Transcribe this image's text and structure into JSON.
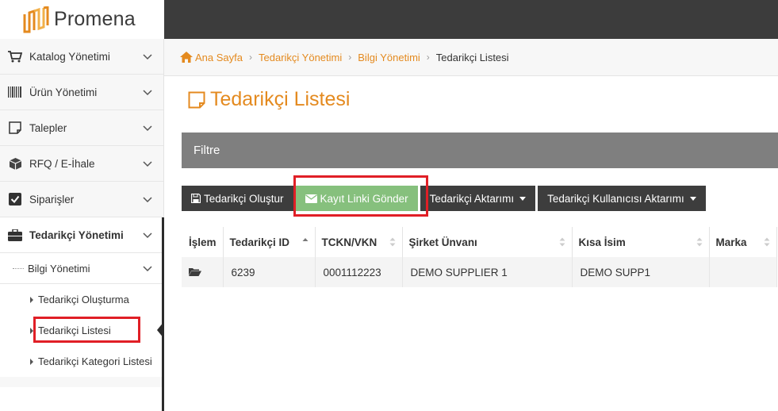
{
  "brand": {
    "name": "Promena",
    "accent": "#e48a1f",
    "highlight": "#e01f26"
  },
  "sidebar": {
    "items": [
      {
        "label": "Katalog Yönetimi",
        "icon": "cart-icon"
      },
      {
        "label": "Ürün Yönetimi",
        "icon": "barcode-icon"
      },
      {
        "label": "Talepler",
        "icon": "note-icon"
      },
      {
        "label": "RFQ / E-İhale",
        "icon": "box-icon"
      },
      {
        "label": "Siparişler",
        "icon": "checkbox-icon"
      },
      {
        "label": "Tedarikçi Yönetimi",
        "icon": "briefcase-icon"
      }
    ],
    "sub": {
      "label": "Bilgi Yönetimi"
    },
    "leaves": [
      {
        "label": "Tedarikçi Oluşturma"
      },
      {
        "label": "Tedarikçi Listesi"
      },
      {
        "label": "Tedarikçi Kategori Listesi"
      }
    ]
  },
  "breadcrumb": {
    "home": "Ana Sayfa",
    "level1": "Tedarikçi Yönetimi",
    "level2": "Bilgi Yönetimi",
    "current": "Tedarikçi Listesi"
  },
  "page": {
    "title": "Tedarikçi Listesi"
  },
  "filter": {
    "label": "Filtre"
  },
  "toolbar": {
    "create": "Tedarikçi Oluştur",
    "send_link": "Kayıt Linki Gönder",
    "transfer": "Tedarikçi Aktarımı",
    "user_transfer": "Tedarikçi Kullanıcısı Aktarımı"
  },
  "table": {
    "headers": [
      "İşlem",
      "Tedarikçi ID",
      "TCKN/VKN",
      "Şirket Ünvanı",
      "Kısa İsim",
      "Marka"
    ],
    "rows": [
      {
        "id": "6239",
        "tckn": "0001112223",
        "company": "DEMO SUPPLIER 1",
        "short": "DEMO SUPP1",
        "brand": ""
      }
    ]
  }
}
